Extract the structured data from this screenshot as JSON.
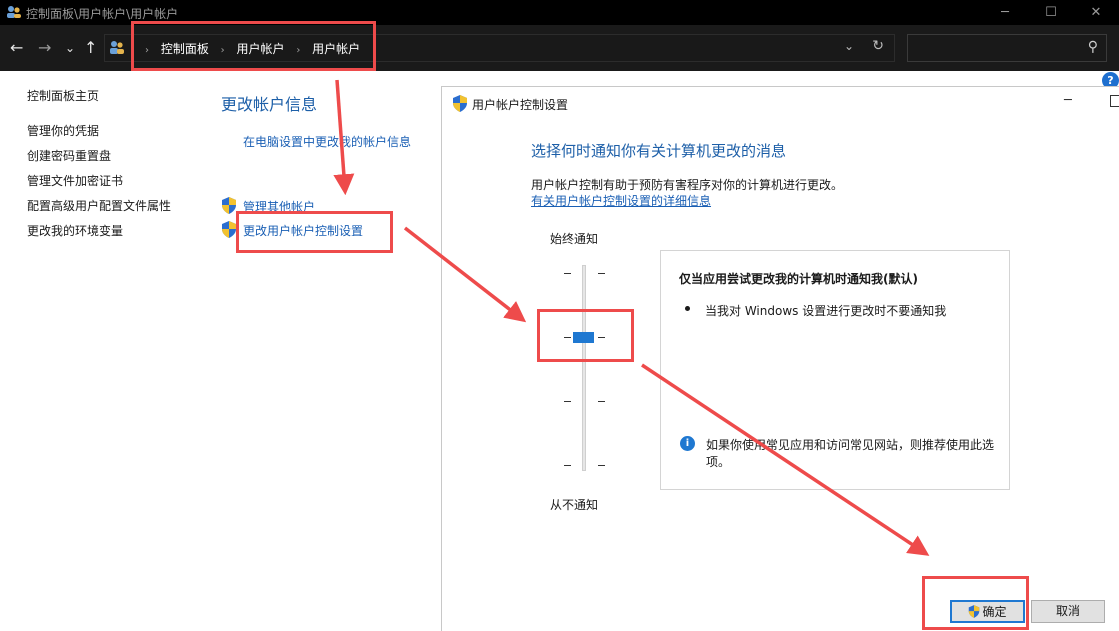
{
  "window": {
    "title": "控制面板\\用户帐户\\用户帐户",
    "minimize": "─",
    "maximize": "☐",
    "close": "✕"
  },
  "nav": {
    "back": "←",
    "forward": "→",
    "recent": "⌄",
    "up": "↑",
    "breadcrumbs": [
      "控制面板",
      "用户帐户",
      "用户帐户"
    ],
    "separator": "›",
    "dropdown": "⌄",
    "refresh": "↻",
    "search_placeholder": "",
    "search_icon": "⚲"
  },
  "sidebar": {
    "items": [
      "控制面板主页",
      "管理你的凭据",
      "创建密码重置盘",
      "管理文件加密证书",
      "配置高级用户配置文件属性",
      "更改我的环境变量"
    ]
  },
  "main": {
    "title": "更改帐户信息",
    "links": [
      "在电脑设置中更改我的帐户信息",
      "管理其他帐户",
      "更改用户帐户控制设置"
    ]
  },
  "help": {
    "label": "?"
  },
  "dialog": {
    "title": "用户帐户控制设置",
    "minimize": "─",
    "heading": "选择何时通知你有关计算机更改的消息",
    "description": "用户帐户控制有助于预防有害程序对你的计算机进行更改。",
    "more_info_link": "有关用户帐户控制设置的详细信息",
    "slider": {
      "top_label": "始终通知",
      "bottom_label": "从不通知",
      "levels": 4,
      "selected_level": 2
    },
    "info": {
      "title": "仅当应用尝试更改我的计算机时通知我(默认)",
      "bullet": "当我对 Windows 设置进行更改时不要通知我",
      "note_icon": "i",
      "note": "如果你使用常见应用和访问常见网站，则推荐使用此选项。"
    },
    "ok": "确定",
    "cancel": "取消"
  },
  "colors": {
    "accent": "#1f78d1",
    "annotation": "#ee4b4b",
    "title_text": "#1d5fa8"
  }
}
